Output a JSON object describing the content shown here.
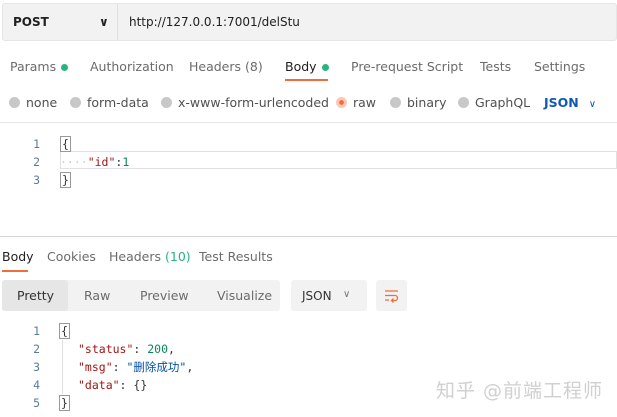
{
  "request": {
    "method": "POST",
    "url": "http://127.0.0.1:7001/delStu"
  },
  "req_tabs": [
    {
      "label": "Params",
      "dot": true
    },
    {
      "label": "Authorization"
    },
    {
      "label": "Headers (8)"
    },
    {
      "label": "Body",
      "dot": true,
      "active": true
    },
    {
      "label": "Pre-request Script"
    },
    {
      "label": "Tests"
    },
    {
      "label": "Settings"
    }
  ],
  "body_types": [
    "none",
    "form-data",
    "x-www-form-urlencoded",
    "raw",
    "binary",
    "GraphQL"
  ],
  "body_format": "JSON",
  "req_body": {
    "lines": [
      "1",
      "2",
      "3"
    ],
    "open": "{",
    "key": "\"id\"",
    "colon": ":",
    "value": "1",
    "close": "}"
  },
  "res_tabs": [
    {
      "label": "Body"
    },
    {
      "label": "Cookies"
    },
    {
      "label": "Headers",
      "count": "(10)"
    },
    {
      "label": "Test Results"
    }
  ],
  "view_modes": [
    "Pretty",
    "Raw",
    "Preview",
    "Visualize"
  ],
  "res_format": "JSON",
  "res_body": {
    "lines": [
      "1",
      "2",
      "3",
      "4",
      "5"
    ],
    "status_key": "\"status\"",
    "status_val": "200",
    "msg_key": "\"msg\"",
    "msg_val": "\"删除成功\"",
    "data_key": "\"data\"",
    "data_val": "{}"
  },
  "watermark": "知乎 @前端工程师",
  "colors": {
    "accent": "#f26b3a",
    "dot": "#26b47f",
    "link": "#0d5ab5"
  }
}
